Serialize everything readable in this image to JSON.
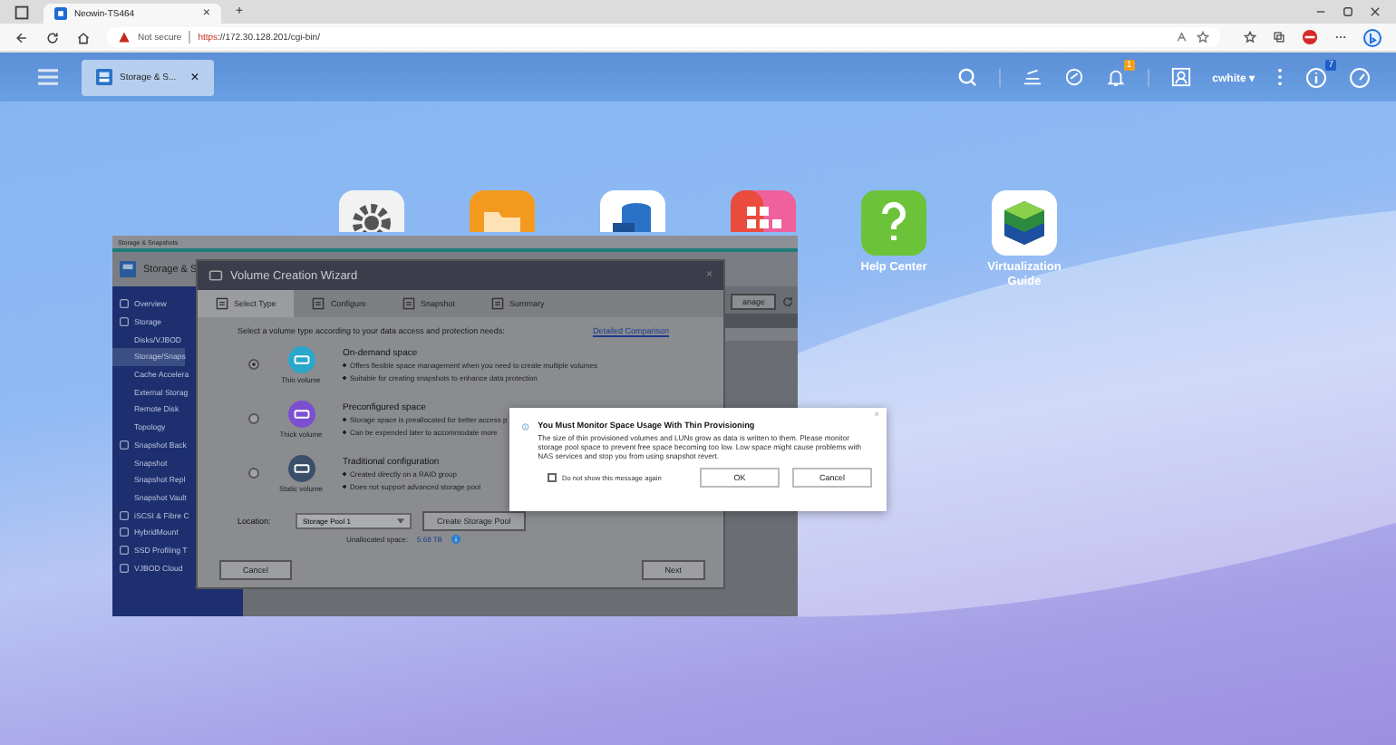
{
  "browser": {
    "tab_title": "Neowin-TS464",
    "tab_close": "×",
    "new_tab": "+",
    "security": "Not secure",
    "url_scheme": "https",
    "url_rest": "://172.30.128.201/cgi-bin/"
  },
  "top_bar": {
    "app_tab": "Storage & S...",
    "app_close": "×",
    "notification_badge": "1",
    "user": "cwhite ▾",
    "info_badge": "7"
  },
  "desktop_icons": [
    {
      "kind": "settings"
    },
    {
      "kind": "folder"
    },
    {
      "kind": "storage"
    },
    {
      "kind": "apps"
    },
    {
      "kind": "help",
      "label": "Help Center"
    },
    {
      "kind": "virtualization",
      "label": "Virtualization Guide"
    }
  ],
  "storage_window": {
    "title": "Storage & Snapshots",
    "header": "Storage & S",
    "manage": "anage",
    "sidebar": [
      {
        "label": "Overview",
        "selected": false
      },
      {
        "label": "Storage",
        "selected": false,
        "children": [
          {
            "label": "Disks/VJBOD",
            "selected": false
          },
          {
            "label": "Storage/Snaps",
            "selected": true
          },
          {
            "label": "Cache Accelera",
            "selected": false
          },
          {
            "label": "External Storag",
            "selected": false
          },
          {
            "label": "Remote Disk",
            "selected": false
          },
          {
            "label": "Topology",
            "selected": false
          }
        ]
      },
      {
        "label": "Snapshot Back",
        "selected": false,
        "children": [
          {
            "label": "Snapshot",
            "selected": false
          },
          {
            "label": "Snapshot Repl",
            "selected": false
          },
          {
            "label": "Snapshot Vault",
            "selected": false
          }
        ]
      },
      {
        "label": "iSCSI & Fibre C",
        "selected": false
      },
      {
        "label": "HybridMount",
        "selected": false
      },
      {
        "label": "SSD Profiling T",
        "selected": false
      },
      {
        "label": "VJBOD Cloud",
        "selected": false
      }
    ]
  },
  "wizard": {
    "title": "Volume Creation Wizard",
    "close": "×",
    "steps": [
      {
        "label": "Select Type",
        "selected": true
      },
      {
        "label": "Configure",
        "selected": false
      },
      {
        "label": "Snapshot",
        "selected": false
      },
      {
        "label": "Summary",
        "selected": false
      }
    ],
    "prompt": "Select a volume type according to your data access and protection needs:",
    "link": "Detailed Comparison",
    "options": [
      {
        "caption": "Thin volume",
        "title": "On-demand space",
        "color": "#2aa7c9",
        "selected": true,
        "bullets": [
          "Offers flexible space management when you need to create multiple volumes",
          "Suitable for creating snapshots to enhance data protection"
        ]
      },
      {
        "caption": "Thick volume",
        "title": "Preconfigured space",
        "color": "#7b4fd0",
        "selected": false,
        "bullets": [
          "Storage space is preallocated for better access p",
          "Can be expended later to accommodate more"
        ]
      },
      {
        "caption": "Static volume",
        "title": "Traditional configuration",
        "color": "#3b4f6b",
        "selected": false,
        "bullets": [
          "Created directly on a RAID group",
          "Does not support advanced storage pool"
        ]
      }
    ],
    "location_label": "Location:",
    "location_value": "Storage Pool 1",
    "create_pool": "Create Storage Pool",
    "unallocated_label": "Unallocated space:",
    "unallocated_value": "5.68 TB",
    "cancel": "Cancel",
    "next": "Next"
  },
  "dialog": {
    "title": "You Must Monitor Space Usage With Thin Provisioning",
    "body": "The size of thin provisioned volumes and LUNs grow as data is written to them. Please monitor storage pool space to prevent free space becoming too low. Low space might cause problems with NAS services and stop you from using snapshot revert.",
    "checkbox_label": "Do not show this message again",
    "checked": false,
    "ok": "OK",
    "cancel": "Cancel",
    "close": "×"
  }
}
